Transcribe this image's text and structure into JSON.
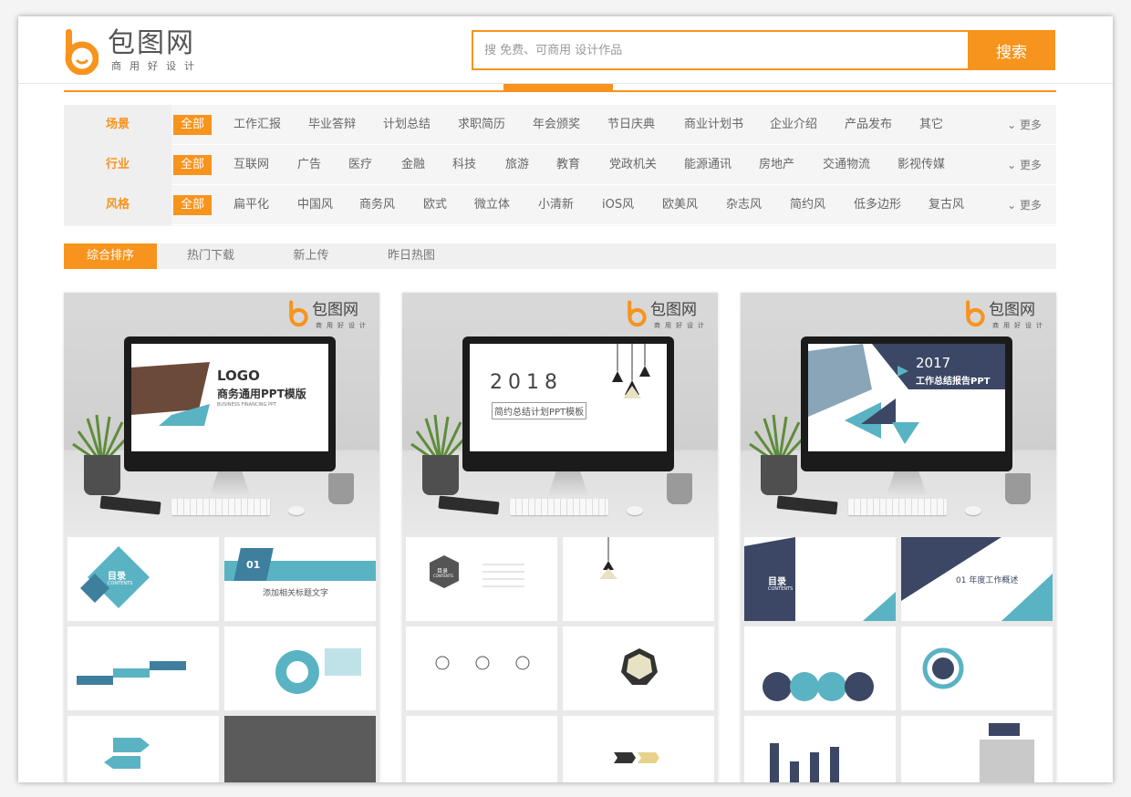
{
  "header": {
    "logo_text": "包图网",
    "logo_sub": "商用好设计",
    "search_placeholder": "搜 免费、可商用 设计作品",
    "search_button": "搜索"
  },
  "filters": [
    {
      "label": "场景",
      "options": [
        "全部",
        "工作汇报",
        "毕业答辩",
        "计划总结",
        "求职简历",
        "年会颁奖",
        "节日庆典",
        "商业计划书",
        "企业介绍",
        "产品发布",
        "其它"
      ],
      "more": "更多"
    },
    {
      "label": "行业",
      "options": [
        "全部",
        "互联网",
        "广告",
        "医疗",
        "金融",
        "科技",
        "旅游",
        "教育",
        "党政机关",
        "能源通讯",
        "房地产",
        "交通物流",
        "影视传媒"
      ],
      "more": "更多"
    },
    {
      "label": "风格",
      "options": [
        "全部",
        "扁平化",
        "中国风",
        "商务风",
        "欧式",
        "微立体",
        "小清新",
        "iOS风",
        "欧美风",
        "杂志风",
        "简约风",
        "低多边形",
        "复古风"
      ],
      "more": "更多"
    }
  ],
  "sort_tabs": [
    "综合排序",
    "热门下载",
    "新上传",
    "昨日热图"
  ],
  "cards": [
    {
      "logo_text": "包图网",
      "logo_sub": "商用好设计",
      "screen_line1": "LOGO",
      "screen_line2": "商务通用PPT模版",
      "screen_line3": "BUSINESS FINANCING PPT",
      "thumb_texts": [
        "目录",
        "CONTENTS",
        "01",
        "添加相关标题文字"
      ]
    },
    {
      "logo_text": "包图网",
      "logo_sub": "商用好设计",
      "screen_line1": "2018",
      "screen_line2": "简约总结计划PPT模板",
      "screen_line3": "",
      "thumb_texts": [
        "目录",
        "CONTENTS"
      ]
    },
    {
      "logo_text": "包图网",
      "logo_sub": "商用好设计",
      "screen_line1": "2017",
      "screen_line2": "工作总结报告PPT",
      "screen_line3": "",
      "thumb_texts": [
        "目录",
        "CONTENTS",
        "01 年度工作概述"
      ]
    }
  ],
  "colors": {
    "accent": "#f7941d",
    "teal": "#5ab3c3",
    "navy": "#3b4764"
  }
}
